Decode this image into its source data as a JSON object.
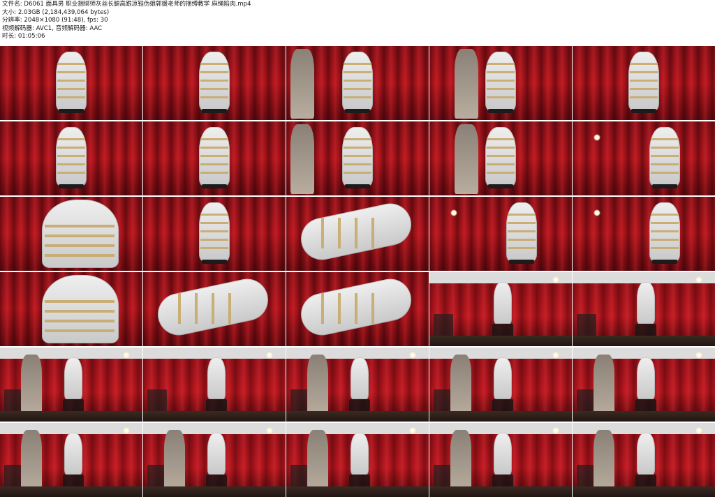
{
  "info": {
    "line1": "文件名: D6061 面具男 职业捆绑师灰丝长腿高跟凉鞋伪娘郭媛老师的捆缚教学 麻绳陷肉.mp4",
    "line2": "大小: 2.03GB (2,184,439,064 bytes)",
    "line3": "分辨率: 2048×1080 (91:48), fps: 30",
    "line4": "视频解码器: AVC1, 音频解码器: AAC",
    "line5": "时长: 01:05:06"
  },
  "thumbnails": [
    {
      "scene": "red",
      "figure": "seated"
    },
    {
      "scene": "red",
      "figure": "standing"
    },
    {
      "scene": "red",
      "figure": "standing-person"
    },
    {
      "scene": "red",
      "figure": "two-people"
    },
    {
      "scene": "red",
      "figure": "standing"
    },
    {
      "scene": "red",
      "figure": "standing"
    },
    {
      "scene": "red",
      "figure": "seated"
    },
    {
      "scene": "red",
      "figure": "standing-person"
    },
    {
      "scene": "red",
      "figure": "two-people"
    },
    {
      "scene": "red",
      "figure": "lamp"
    },
    {
      "scene": "red",
      "figure": "closeup"
    },
    {
      "scene": "red",
      "figure": "standing"
    },
    {
      "scene": "red",
      "figure": "closeup-legs"
    },
    {
      "scene": "red",
      "figure": "lamp"
    },
    {
      "scene": "red",
      "figure": "lamp"
    },
    {
      "scene": "red",
      "figure": "closeup"
    },
    {
      "scene": "red",
      "figure": "closeup-legs"
    },
    {
      "scene": "red",
      "figure": "closeup-legs"
    },
    {
      "scene": "studio",
      "figure": "studio"
    },
    {
      "scene": "studio",
      "figure": "studio"
    },
    {
      "scene": "studio",
      "figure": "studio-person"
    },
    {
      "scene": "studio",
      "figure": "studio"
    },
    {
      "scene": "studio",
      "figure": "studio-person"
    },
    {
      "scene": "studio",
      "figure": "studio-person"
    },
    {
      "scene": "studio",
      "figure": "studio-person"
    },
    {
      "scene": "studio",
      "figure": "studio-person"
    },
    {
      "scene": "studio",
      "figure": "studio-person"
    },
    {
      "scene": "studio",
      "figure": "studio-person"
    },
    {
      "scene": "studio",
      "figure": "studio-person"
    },
    {
      "scene": "studio",
      "figure": "studio-person"
    }
  ]
}
